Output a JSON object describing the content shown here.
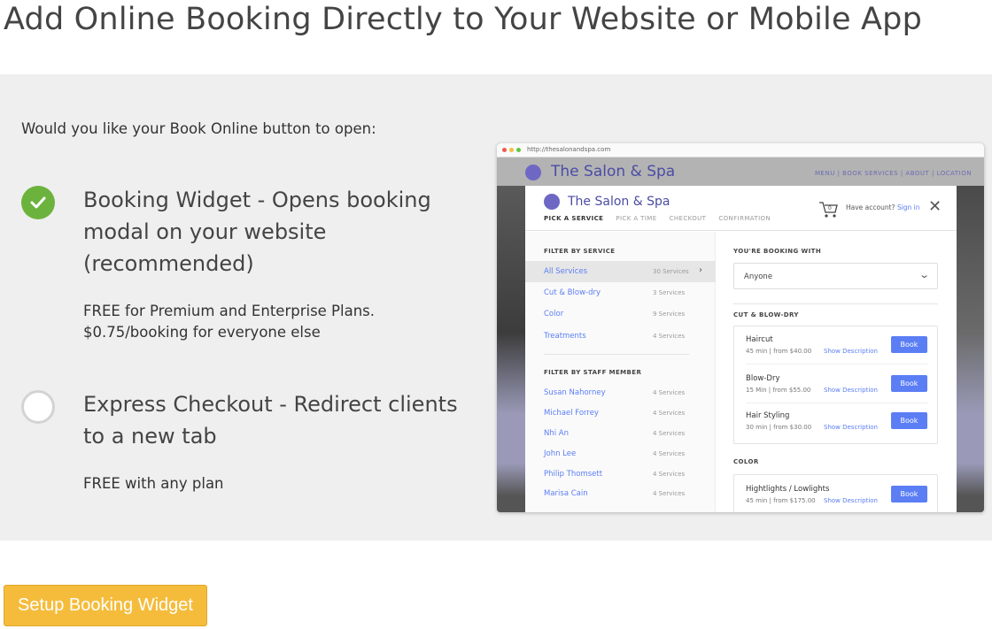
{
  "page": {
    "title": "Add Online Booking Directly to Your Website or Mobile App"
  },
  "question": "Would you like your Book Online button to open:",
  "options": [
    {
      "title": "Booking Widget - Opens booking modal on your website (recommended)",
      "description_lines": [
        "FREE for Premium and Enterprise Plans.",
        "$0.75/booking for everyone else"
      ],
      "selected": true
    },
    {
      "title": "Express Checkout - Redirect clients to a new tab",
      "description_lines": [
        "FREE with any plan"
      ],
      "selected": false
    }
  ],
  "preview": {
    "url": "http://thesalonandspa.com",
    "site_name": "The Salon & Spa",
    "site_nav": "MENU | BOOK SERVICES | ABOUT | LOCATION",
    "modal": {
      "business_name": "The Salon & Spa",
      "steps": [
        "PICK A SERVICE",
        "PICK A TIME",
        "CHECKOUT",
        "CONFIRMATION"
      ],
      "cart_count": "0",
      "account_text": "Have account?",
      "sign_in": "Sign in",
      "filter_by_service_label": "FILTER BY SERVICE",
      "service_filters": [
        {
          "name": "All Services",
          "count": "30 Services"
        },
        {
          "name": "Cut & Blow-dry",
          "count": "3 Services"
        },
        {
          "name": "Color",
          "count": "9 Services"
        },
        {
          "name": "Treatments",
          "count": "4 Services"
        }
      ],
      "filter_by_staff_label": "FILTER BY STAFF MEMBER",
      "staff_filters": [
        {
          "name": "Susan Nahorney",
          "count": "4 Services"
        },
        {
          "name": "Michael Forrey",
          "count": "4 Services"
        },
        {
          "name": "Nhi An",
          "count": "4 Services"
        },
        {
          "name": "John Lee",
          "count": "4 Services"
        },
        {
          "name": "Philip Thomsett",
          "count": "4 Services"
        },
        {
          "name": "Marisa Cain",
          "count": "4 Services"
        }
      ],
      "booking_with_label": "YOU'RE BOOKING WITH",
      "booking_with_value": "Anyone",
      "cut_section_label": "CUT & BLOW-DRY",
      "cut_services": [
        {
          "name": "Haircut",
          "meta": "45 min | from $40.00",
          "desc": "Show Description",
          "book": "Book"
        },
        {
          "name": "Blow-Dry",
          "meta": "15 Min | from $55.00",
          "desc": "Show Description",
          "book": "Book"
        },
        {
          "name": "Hair Styling",
          "meta": "30 min | from $30.00",
          "desc": "Show Description",
          "book": "Book"
        }
      ],
      "color_section_label": "COLOR",
      "color_services": [
        {
          "name": "Hightlights / Lowlights",
          "meta": "45 min | from $175.00",
          "desc": "Show Description",
          "book": "Book"
        }
      ]
    }
  },
  "setup_button": "Setup Booking Widget",
  "colors": {
    "accent_green": "#6cb33e",
    "button_yellow": "#f5bc3c",
    "link_blue": "#5b7ef5",
    "brand_purple": "#4b4ca6"
  }
}
